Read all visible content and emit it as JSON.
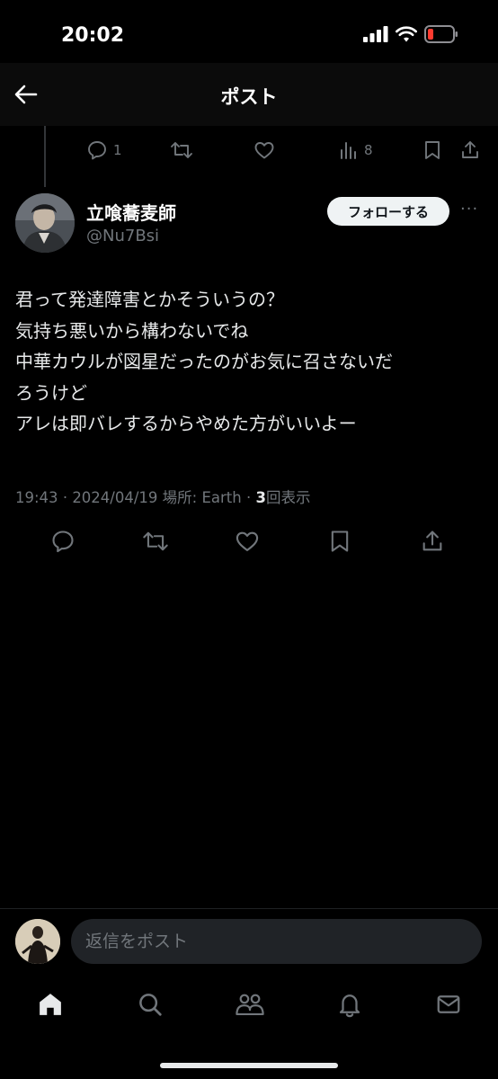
{
  "status_bar": {
    "time": "20:02"
  },
  "header": {
    "title": "ポスト"
  },
  "prev_post_actions": {
    "replies": "1",
    "views": "8"
  },
  "post": {
    "author_name": "立喰蕎麦師",
    "handle": "@Nu7Bsi",
    "follow_label": "フォローする",
    "more_label": "···",
    "lines": [
      "君って発達障害とかそういうの？",
      "気持ち悪いから構わないでね",
      "中華カウルが図星だったのがお気に召さないだ",
      "ろうけど",
      "アレは即バレするからやめた方がいいよー"
    ],
    "time": "19:43",
    "date": "2024/04/19",
    "location_prefix": "場所: ",
    "location": "Earth",
    "separator": "·",
    "views_count": "3",
    "views_label": "回表示"
  },
  "reply": {
    "placeholder": "返信をポスト"
  },
  "colors": {
    "background": "#000000",
    "text": "#e7e9ea",
    "muted": "#71767b",
    "battery": "#ff3b30"
  },
  "icons": {
    "header": [
      "back-arrow-icon"
    ],
    "post_actions": [
      "reply-icon",
      "repost-icon",
      "like-icon",
      "bookmark-icon",
      "share-icon"
    ],
    "tabs": [
      "home-icon",
      "search-icon",
      "communities-icon",
      "notifications-icon",
      "messages-icon"
    ]
  }
}
